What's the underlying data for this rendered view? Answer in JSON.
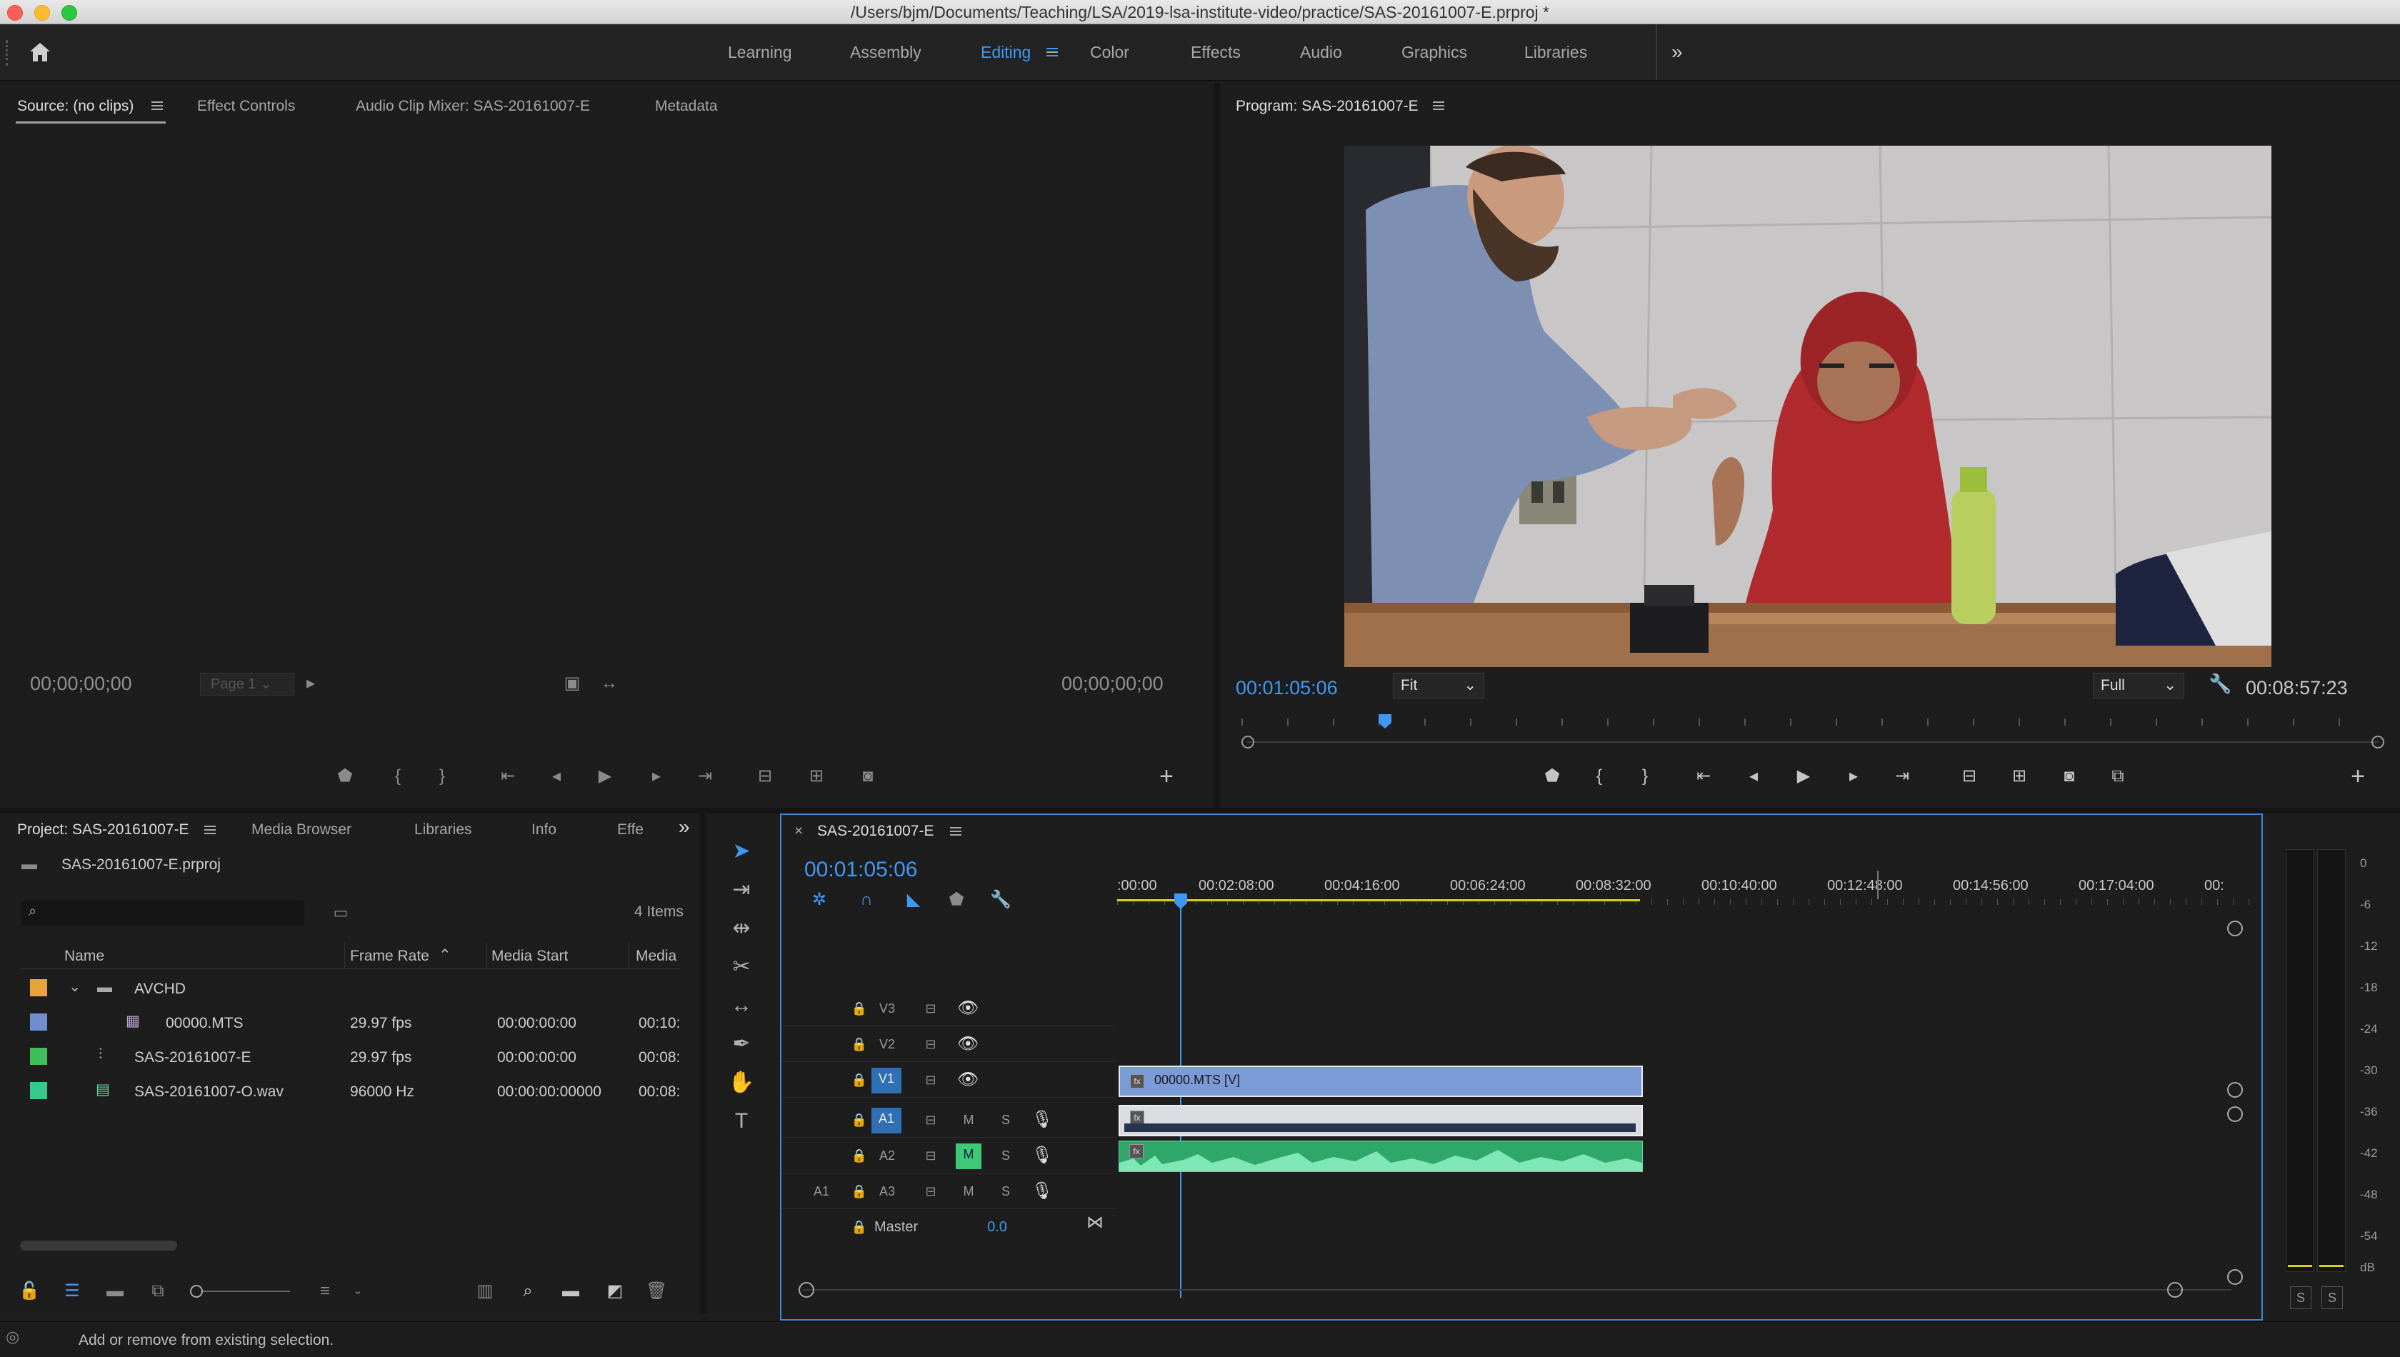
{
  "window": {
    "title": "/Users/bjm/Documents/Teaching/LSA/2019-lsa-institute-video/practice/SAS-20161007-E.prproj *"
  },
  "workspaces": [
    "Learning",
    "Assembly",
    "Editing",
    "Color",
    "Effects",
    "Audio",
    "Graphics",
    "Libraries"
  ],
  "active_workspace": "Editing",
  "source": {
    "tabs": [
      "Source: (no clips)",
      "Effect Controls",
      "Audio Clip Mixer: SAS-20161007-E",
      "Metadata"
    ],
    "tc_in": "00;00;00;00",
    "tc_out": "00;00;00;00",
    "page": "Page 1"
  },
  "program": {
    "title": "Program: SAS-20161007-E",
    "timecode": "00:01:05:06",
    "fit": "Fit",
    "quality": "Full",
    "duration": "00:08:57:23",
    "playhead_fraction": 0.12
  },
  "project": {
    "tabs": [
      "Project: SAS-20161007-E",
      "Media Browser",
      "Libraries",
      "Info",
      "Effe"
    ],
    "file": "SAS-20161007-E.prproj",
    "item_count": "4 Items",
    "columns": [
      "Name",
      "Frame Rate",
      "Media Start",
      "Media"
    ],
    "rows": [
      {
        "name": "AVCHD",
        "fps": "",
        "start": "",
        "media": "",
        "color": "#e8a33b"
      },
      {
        "name": "00000.MTS",
        "fps": "29.97 fps",
        "start": "00:00:00:00",
        "media": "00:10:",
        "color": "#6f8fcf"
      },
      {
        "name": "SAS-20161007-E",
        "fps": "29.97 fps",
        "start": "00:00:00:00",
        "media": "00:08:",
        "color": "#3fbf5a"
      },
      {
        "name": "SAS-20161007-O.wav",
        "fps": "96000 Hz",
        "start": "00:00:00:00000",
        "media": "00:08:",
        "color": "#35c98a"
      }
    ]
  },
  "timeline": {
    "name": "SAS-20161007-E",
    "timecode": "00:01:05:06",
    "ruler": [
      ":00:00",
      "00:02:08:00",
      "00:04:16:00",
      "00:06:24:00",
      "00:08:32:00",
      "00:10:40:00",
      "00:12:48:00",
      "00:14:56:00",
      "00:17:04:00",
      "00:"
    ],
    "video_tracks": [
      "V3",
      "V2",
      "V1"
    ],
    "audio_tracks": [
      "A1",
      "A2",
      "A3"
    ],
    "source_patch": "A1",
    "m": "M",
    "s": "S",
    "master_label": "Master",
    "master_value": "0.0",
    "clip_label": "00000.MTS [V]",
    "fx": "fx"
  },
  "meter": {
    "scale": [
      "0",
      "-6",
      "-12",
      "-18",
      "-24",
      "-30",
      "-36",
      "-42",
      "-48",
      "-54",
      "dB"
    ],
    "solo": [
      "S",
      "S"
    ]
  },
  "status": {
    "text": "Add or remove from existing selection."
  },
  "colors": {
    "accent": "#3f98f5",
    "video_clip": "#7b9bd8",
    "audio_clip": "#2fa76a",
    "workarea": "#d8d31a"
  }
}
